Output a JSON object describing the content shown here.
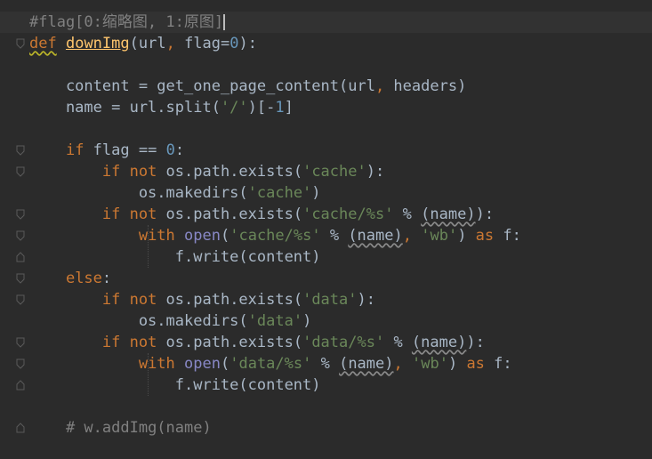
{
  "editor": {
    "language": "python",
    "theme_colors": {
      "background": "#2b2b2b",
      "current_line": "#323232",
      "keyword": "#cc7832",
      "number": "#6897bb",
      "string": "#6a8759",
      "comment": "#808080",
      "function_name": "#ffc66d",
      "default_text": "#a9b7c6"
    },
    "lines": [
      {
        "tokens": [
          {
            "t": "cmt",
            "v": "#flag[0:缩略图, 1:原图]"
          }
        ]
      },
      {
        "tokens": [
          {
            "t": "kw",
            "v": "def",
            "w": "y"
          },
          {
            "t": "plain",
            "v": " "
          },
          {
            "t": "fn def-name",
            "v": "downImg"
          },
          {
            "t": "plain",
            "v": "(url"
          },
          {
            "t": "kw",
            "v": ","
          },
          {
            "t": "plain",
            "v": " flag="
          },
          {
            "t": "num",
            "v": "0"
          },
          {
            "t": "plain",
            "v": "):"
          }
        ]
      },
      {
        "tokens": []
      },
      {
        "tokens": [
          {
            "t": "plain",
            "v": "    content = get_one_page_content(url"
          },
          {
            "t": "kw",
            "v": ","
          },
          {
            "t": "plain",
            "v": " headers)"
          }
        ]
      },
      {
        "tokens": [
          {
            "t": "plain",
            "v": "    name = url.split("
          },
          {
            "t": "str",
            "v": "'/'"
          },
          {
            "t": "plain",
            "v": ")[-"
          },
          {
            "t": "num",
            "v": "1"
          },
          {
            "t": "plain",
            "v": "]"
          }
        ]
      },
      {
        "tokens": []
      },
      {
        "tokens": [
          {
            "t": "plain",
            "v": "    "
          },
          {
            "t": "kw",
            "v": "if"
          },
          {
            "t": "plain",
            "v": " flag == "
          },
          {
            "t": "num",
            "v": "0"
          },
          {
            "t": "plain",
            "v": ":"
          }
        ]
      },
      {
        "tokens": [
          {
            "t": "plain",
            "v": "        "
          },
          {
            "t": "kw",
            "v": "if not"
          },
          {
            "t": "plain",
            "v": " os.path.exists("
          },
          {
            "t": "str",
            "v": "'cache'"
          },
          {
            "t": "plain",
            "v": "):"
          }
        ]
      },
      {
        "tokens": [
          {
            "t": "plain",
            "v": "            os.makedirs("
          },
          {
            "t": "str",
            "v": "'cache'"
          },
          {
            "t": "plain",
            "v": ")"
          }
        ]
      },
      {
        "tokens": [
          {
            "t": "plain",
            "v": "        "
          },
          {
            "t": "kw",
            "v": "if not"
          },
          {
            "t": "plain",
            "v": " os.path.exists("
          },
          {
            "t": "str",
            "v": "'cache/%s'"
          },
          {
            "t": "plain",
            "v": " % "
          },
          {
            "t": "plain",
            "v": "(name)",
            "w": "w"
          },
          {
            "t": "plain",
            "v": "):"
          }
        ]
      },
      {
        "tokens": [
          {
            "t": "plain",
            "v": "            "
          },
          {
            "t": "kw",
            "v": "with"
          },
          {
            "t": "plain",
            "v": " "
          },
          {
            "t": "builtin",
            "v": "open"
          },
          {
            "t": "plain",
            "v": "("
          },
          {
            "t": "str",
            "v": "'cache/%s'"
          },
          {
            "t": "plain",
            "v": " % "
          },
          {
            "t": "plain",
            "v": "(name)",
            "w": "w"
          },
          {
            "t": "kw",
            "v": ","
          },
          {
            "t": "plain",
            "v": " "
          },
          {
            "t": "str",
            "v": "'wb'"
          },
          {
            "t": "plain",
            "v": ") "
          },
          {
            "t": "kw",
            "v": "as"
          },
          {
            "t": "plain",
            "v": " f:"
          }
        ]
      },
      {
        "tokens": [
          {
            "t": "plain",
            "v": "                f.write(content)"
          }
        ]
      },
      {
        "tokens": [
          {
            "t": "plain",
            "v": "    "
          },
          {
            "t": "kw",
            "v": "else"
          },
          {
            "t": "plain",
            "v": ":"
          }
        ]
      },
      {
        "tokens": [
          {
            "t": "plain",
            "v": "        "
          },
          {
            "t": "kw",
            "v": "if not"
          },
          {
            "t": "plain",
            "v": " os.path.exists("
          },
          {
            "t": "str",
            "v": "'data'"
          },
          {
            "t": "plain",
            "v": "):"
          }
        ]
      },
      {
        "tokens": [
          {
            "t": "plain",
            "v": "            os.makedirs("
          },
          {
            "t": "str",
            "v": "'data'"
          },
          {
            "t": "plain",
            "v": ")"
          }
        ]
      },
      {
        "tokens": [
          {
            "t": "plain",
            "v": "        "
          },
          {
            "t": "kw",
            "v": "if not"
          },
          {
            "t": "plain",
            "v": " os.path.exists("
          },
          {
            "t": "str",
            "v": "'data/%s'"
          },
          {
            "t": "plain",
            "v": " % "
          },
          {
            "t": "plain",
            "v": "(name)",
            "w": "w"
          },
          {
            "t": "plain",
            "v": "):"
          }
        ]
      },
      {
        "tokens": [
          {
            "t": "plain",
            "v": "            "
          },
          {
            "t": "kw",
            "v": "with"
          },
          {
            "t": "plain",
            "v": " "
          },
          {
            "t": "builtin",
            "v": "open"
          },
          {
            "t": "plain",
            "v": "("
          },
          {
            "t": "str",
            "v": "'data/%s'"
          },
          {
            "t": "plain",
            "v": " % "
          },
          {
            "t": "plain",
            "v": "(name)",
            "w": "w"
          },
          {
            "t": "kw",
            "v": ","
          },
          {
            "t": "plain",
            "v": " "
          },
          {
            "t": "str",
            "v": "'wb'"
          },
          {
            "t": "plain",
            "v": ") "
          },
          {
            "t": "kw",
            "v": "as"
          },
          {
            "t": "plain",
            "v": " f:"
          }
        ]
      },
      {
        "tokens": [
          {
            "t": "plain",
            "v": "                f.write(content)"
          }
        ]
      },
      {
        "tokens": []
      },
      {
        "tokens": [
          {
            "t": "plain",
            "v": "    "
          },
          {
            "t": "cmt",
            "v": "# w.addImg(name)"
          }
        ]
      }
    ]
  }
}
